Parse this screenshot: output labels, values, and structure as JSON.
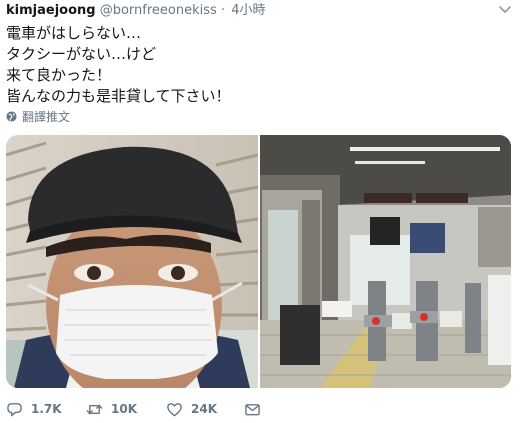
{
  "tweet": {
    "display_name": "kimjaejoong",
    "handle": "@bornfreeonekiss",
    "separator": "·",
    "time": "4小時",
    "lines": [
      "電車がはしらない…",
      "タクシーがない…けど",
      "来て良かった！",
      "皆んなの力も是非貸して下さい！"
    ],
    "translate_label": "翻譯推文"
  },
  "stats": {
    "replies": "1.7K",
    "retweets": "10K",
    "likes": "24K"
  },
  "icons": {
    "caret": "chevron-down-icon",
    "globe": "globe-icon",
    "reply": "reply-icon",
    "retweet": "retweet-icon",
    "like": "heart-icon",
    "message": "envelope-icon"
  },
  "colors": {
    "text": "#14171a",
    "secondary": "#657786"
  }
}
